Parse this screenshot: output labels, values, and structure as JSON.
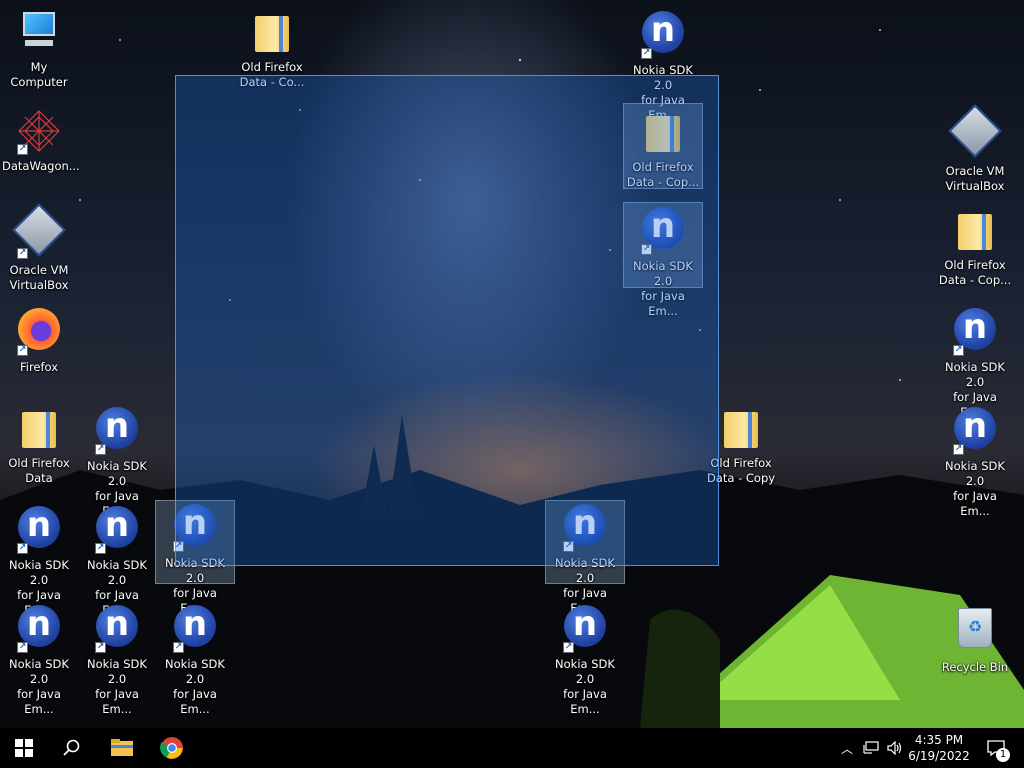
{
  "desktop": {
    "icons": {
      "my_computer": "My Computer",
      "datawagon": "DataWagon...",
      "oracle_left": "Oracle VM\nVirtualBox",
      "firefox": "Firefox",
      "old_firefox_data": "Old Firefox\nData",
      "nokia": "Nokia SDK 2.0\nfor Java Em...",
      "old_firefox_top": "Old Firefox\nData - Co...",
      "old_firefox_copy_sel": "Old Firefox\nData - Cop...",
      "old_firefox_copy_mid": "Old Firefox\nData - Copy",
      "oracle_right": "Oracle VM\nVirtualBox",
      "old_firefox_copy_right": "Old Firefox\nData - Cop...",
      "recycle_bin": "Recycle Bin"
    }
  },
  "taskbar": {
    "start_icon": "windows-start-icon",
    "search_icon": "search-icon",
    "explorer_icon": "file-explorer-icon",
    "chrome_icon": "chrome-icon",
    "time": "4:35 PM",
    "date": "6/19/2022",
    "notification_count": "1"
  }
}
